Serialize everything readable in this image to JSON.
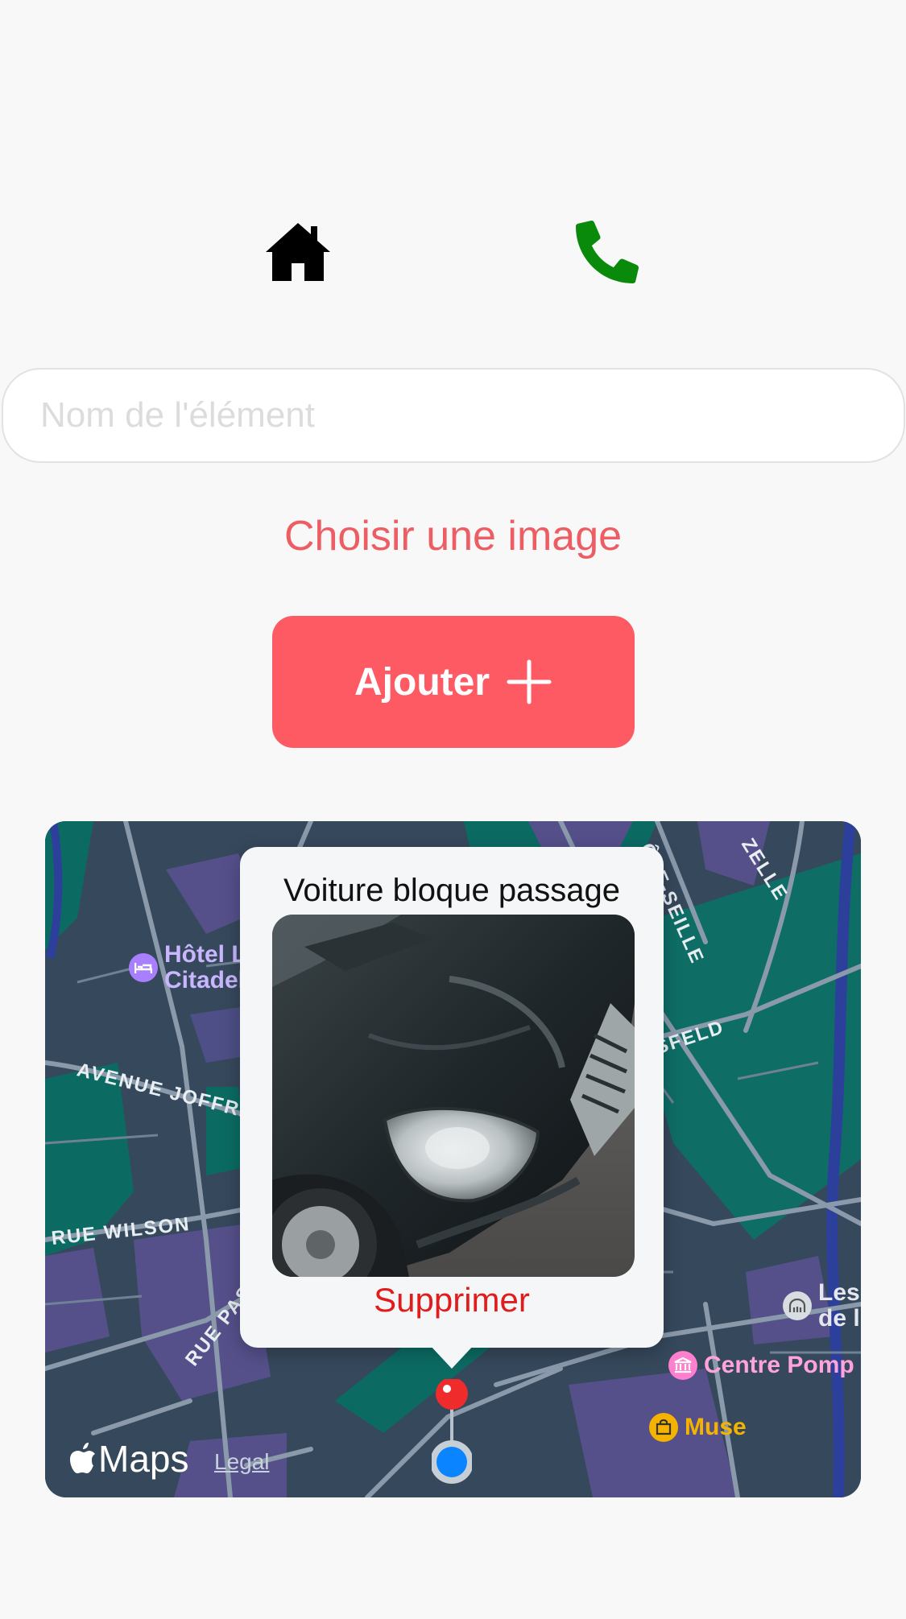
{
  "nav": {
    "home_icon": "home-icon",
    "phone_icon": "phone-icon",
    "phone_color": "#0a8a0a"
  },
  "form": {
    "name_placeholder": "Nom de l'élément",
    "name_value": "",
    "choose_image_label": "Choisir une image",
    "add_button_label": "Ajouter",
    "add_icon": "plus-icon",
    "accent_color": "#fd5a63"
  },
  "map": {
    "streets": [
      "AVENUE JOFFRE",
      "RUE WILSON",
      "RUE PASTEUR",
      "ÔTE-SEILLE",
      "ZELLE",
      "ASFELD"
    ],
    "pois": [
      {
        "name": "Hôtel La Citadelle",
        "line1": "Hôtel La",
        "line2": "Citadelle",
        "icon": "bed-icon",
        "color": "#a880ff"
      },
      {
        "name": "Centre Pompidou",
        "line1": "Centre Pomp",
        "icon": "museum-icon",
        "color": "#ff7fcf"
      },
      {
        "name": "Musée",
        "line1": "Muse",
        "icon": "bag-icon",
        "color": "#f5b300"
      },
      {
        "name": "Les ...",
        "line1": "Les",
        "line2": "de l",
        "icon": "tunnel-icon",
        "color": "#d8dde2"
      }
    ],
    "brand": "Maps",
    "legal": "Legal",
    "callout": {
      "title": "Voiture bloque passage",
      "image_alt": "car-photo",
      "delete_label": "Supprimer"
    }
  }
}
